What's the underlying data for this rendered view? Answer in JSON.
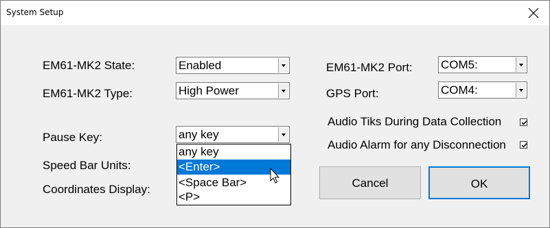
{
  "window": {
    "title": "System Setup",
    "accent": "#0078d7"
  },
  "fields": {
    "state_label": "EM61-MK2 State:",
    "state_value": "Enabled",
    "type_label": "EM61-MK2 Type:",
    "type_value": "High Power",
    "pause_label": "Pause Key:",
    "pause_value": "any key",
    "speed_label": "Speed Bar Units:",
    "coords_label": "Coordinates Display:",
    "port_label": "EM61-MK2 Port:",
    "port_value": "COM5:",
    "gps_label": "GPS Port:",
    "gps_value": "COM4:"
  },
  "checkboxes": {
    "audio_tiks_label": "Audio Tiks During Data Collection",
    "audio_tiks_checked": true,
    "audio_alarm_label": "Audio Alarm for any Disconnection",
    "audio_alarm_checked": true
  },
  "pause_dropdown": {
    "options": [
      "any key",
      "<Enter>",
      "<Space Bar>",
      "<P>"
    ],
    "highlighted": "<Enter>"
  },
  "buttons": {
    "cancel": "Cancel",
    "ok": "OK"
  }
}
